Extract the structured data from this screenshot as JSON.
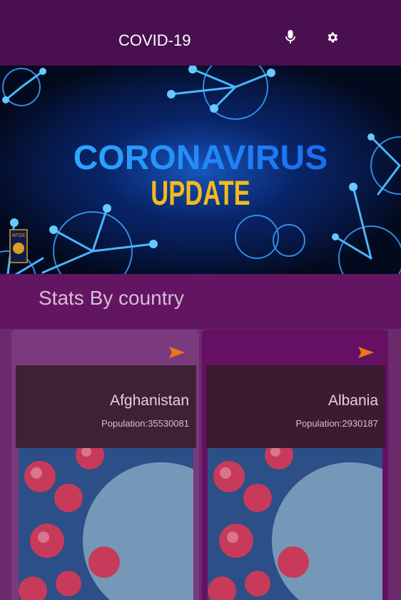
{
  "header": {
    "title": "COVID-19",
    "mic_icon": "microphone-icon",
    "settings_icon": "gear-icon"
  },
  "banner": {
    "line1": "CORONAVIRUS",
    "line2": "UPDATE",
    "badge": "AFGE"
  },
  "section": {
    "title": "Stats By country"
  },
  "countries": [
    {
      "name": "Afghanistan",
      "population_label": "Population:",
      "population": "35530081"
    },
    {
      "name": "Albania",
      "population_label": "Population:",
      "population": "2930187"
    }
  ],
  "colors": {
    "header_bg": "#4a0f4f",
    "section_bg": "#621561",
    "arrow": "#e8761a",
    "banner_blue": "#1f8dff",
    "banner_yellow": "#f5b91e"
  }
}
